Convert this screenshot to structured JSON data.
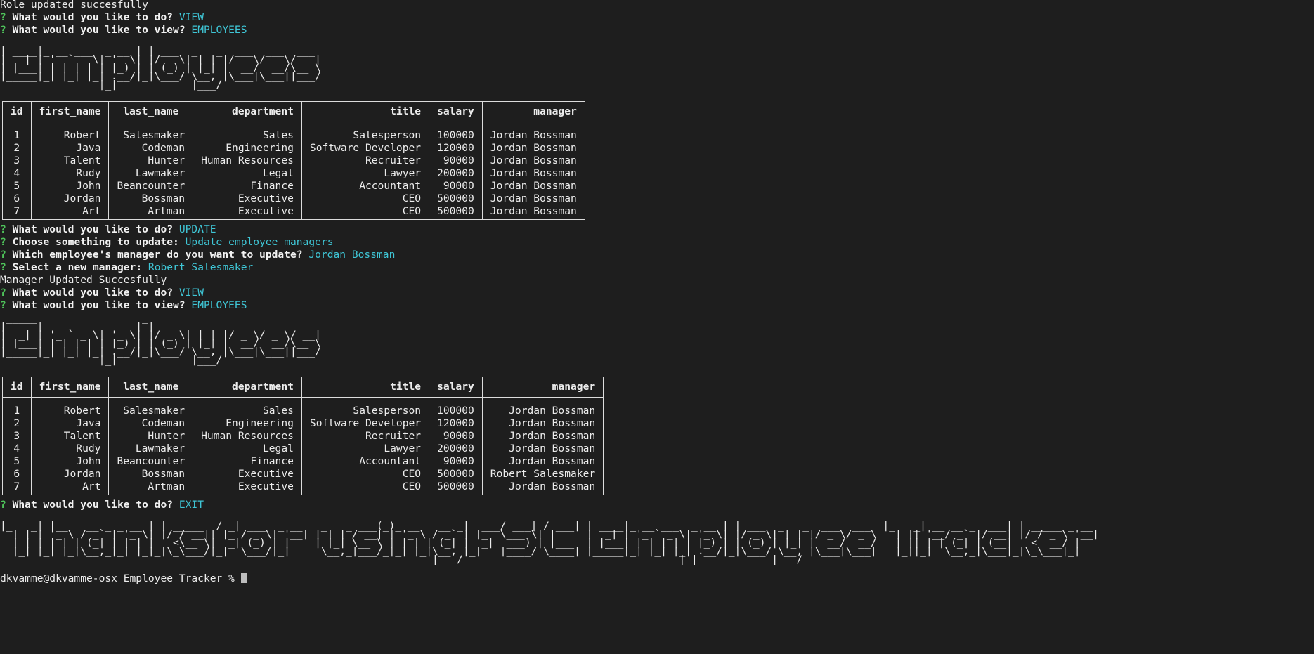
{
  "messages": {
    "role_updated": "Role updated succesfully",
    "manager_updated": "Manager Updated Succesfully"
  },
  "prompts": {
    "q_mark": "?",
    "what_do": "What would you like to do?",
    "what_view": "What would you like to view?",
    "choose_update": "Choose something to update:",
    "which_employee": "Which employee's manager do you want to update?",
    "select_manager": "Select a new manager:"
  },
  "answers": {
    "view_1": "VIEW",
    "employees_1": "EMPLOYEES",
    "update": "UPDATE",
    "update_choice": "Update employee managers",
    "employee_choice": "Jordan Bossman",
    "manager_choice": "Robert Salesmaker",
    "view_2": "VIEW",
    "employees_2": "EMPLOYEES",
    "exit": "EXIT"
  },
  "banners": {
    "employees": " _____                 _\n| ____|_ __ ___  _ __ | | ___  _   _  ___  ___  ___\n|  _| | '_ ` _ \\| '_ \\| |/ _ \\| | | |/ _ \\/ _ \\/ __|\n| |___| | | | | | |_) | | (_) | |_| |  __/  __/\\__ \\\n|_____|_| |_| |_| .__/|_|\\___/ \\__, |\\___|\\___||___/\n                |_|            |___/",
    "thanks": " _____ _                 _          __                       _             _____ ____   ____   _____                 _                         _____               _\n|_   _| |__   __ _ _ __ | | _____  / _| ___  _ __   _   _ ___(_)_ __   __ _|  ___/ ___| / ___| | ____|_ __ ___  _ __ | | ___  _   _  ___  ___  |_   _| __ __ _  ___| | _____ _ __\n  | | | '_ \\ / _` | '_ \\| |/ / __|| |_ / _ \\| '__| | | | / __| | '_ \\ / _` | |_  \\___ \\| |     |  _| | '_ ` _ \\| '_ \\| |/ _ \\| | | |/ _ \\/ _ \\   | || '__/ _` |/ __| |/ / _ \\ '__|\n  | | | | | | (_| | | | |   <\\__ \\|  _| (_) | |    | |_| \\__ \\ | | | | (_| |  _|  ___) | |___  | |___| | | | | | |_) | | (_) | |_| |  __/  __/   | || | | (_| | (__|   <  __/ |\n  |_| |_| |_|\\__,_|_| |_|_|\\_\\___/|_|  \\___/|_|     \\__,_|___/_|_| |_|\\__, |_|   |____/ \\____| |_____|_| |_| |_| .__/|_|\\___/ \\__, |\\___|\\___|   |_||_|  \\__,_|\\___|_|\\_\\___|_|\n                                                                      |___/                                   |_|            |___/"
  },
  "table": {
    "headers": [
      "id",
      "first_name",
      "last_name",
      "department",
      "title",
      "salary",
      "manager"
    ],
    "before": [
      [
        "1",
        "Robert",
        "Salesmaker",
        "Sales",
        "Salesperson",
        "100000",
        "Jordan Bossman"
      ],
      [
        "2",
        "Java",
        "Codeman",
        "Engineering",
        "Software Developer",
        "120000",
        "Jordan Bossman"
      ],
      [
        "3",
        "Talent",
        "Hunter",
        "Human Resources",
        "Recruiter",
        "90000",
        "Jordan Bossman"
      ],
      [
        "4",
        "Rudy",
        "Lawmaker",
        "Legal",
        "Lawyer",
        "200000",
        "Jordan Bossman"
      ],
      [
        "5",
        "John",
        "Beancounter",
        "Finance",
        "Accountant",
        "90000",
        "Jordan Bossman"
      ],
      [
        "6",
        "Jordan",
        "Bossman",
        "Executive",
        "CEO",
        "500000",
        "Jordan Bossman"
      ],
      [
        "7",
        "Art",
        "Artman",
        "Executive",
        "CEO",
        "500000",
        "Jordan Bossman"
      ]
    ],
    "after": [
      [
        "1",
        "Robert",
        "Salesmaker",
        "Sales",
        "Salesperson",
        "100000",
        "Jordan Bossman"
      ],
      [
        "2",
        "Java",
        "Codeman",
        "Engineering",
        "Software Developer",
        "120000",
        "Jordan Bossman"
      ],
      [
        "3",
        "Talent",
        "Hunter",
        "Human Resources",
        "Recruiter",
        "90000",
        "Jordan Bossman"
      ],
      [
        "4",
        "Rudy",
        "Lawmaker",
        "Legal",
        "Lawyer",
        "200000",
        "Jordan Bossman"
      ],
      [
        "5",
        "John",
        "Beancounter",
        "Finance",
        "Accountant",
        "90000",
        "Jordan Bossman"
      ],
      [
        "6",
        "Jordan",
        "Bossman",
        "Executive",
        "CEO",
        "500000",
        "Robert Salesmaker"
      ],
      [
        "7",
        "Art",
        "Artman",
        "Executive",
        "CEO",
        "500000",
        "Jordan Bossman"
      ]
    ]
  },
  "shell": {
    "prompt": "dkvamme@dkvamme-osx Employee_Tracker % "
  },
  "colors": {
    "background": "#1e1e1e",
    "question_mark": "#4ec25a",
    "answer": "#3fc6d6",
    "text": "#ececec"
  }
}
